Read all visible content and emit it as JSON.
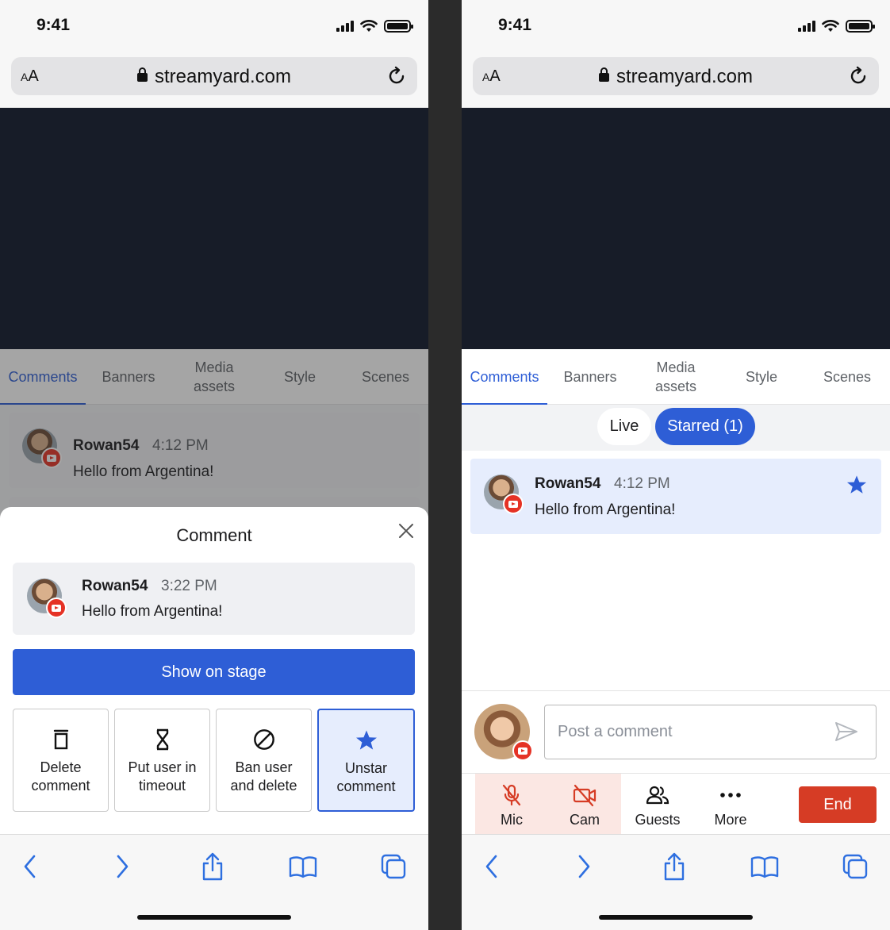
{
  "status_bar": {
    "time": "9:41"
  },
  "browser": {
    "aa_small": "A",
    "aa_large": "A",
    "url": "streamyard.com"
  },
  "tabs": [
    {
      "line1": "Comments",
      "line2": ""
    },
    {
      "line1": "Banners",
      "line2": ""
    },
    {
      "line1": "Media",
      "line2": "assets"
    },
    {
      "line1": "Style",
      "line2": ""
    },
    {
      "line1": "Scenes",
      "line2": ""
    }
  ],
  "left": {
    "background_comment": {
      "author": "Rowan54",
      "time": "4:12 PM",
      "text": "Hello from Argentina!"
    },
    "sheet": {
      "title": "Comment",
      "comment": {
        "author": "Rowan54",
        "time": "3:22 PM",
        "text": "Hello from Argentina!"
      },
      "show_on_stage": "Show on stage",
      "actions": [
        {
          "line1": "Delete",
          "line2": "comment",
          "icon": "trash-icon"
        },
        {
          "line1": "Put user in",
          "line2": "timeout",
          "icon": "hourglass-icon"
        },
        {
          "line1": "Ban user",
          "line2": "and delete",
          "icon": "ban-icon"
        },
        {
          "line1": "Unstar",
          "line2": "comment",
          "icon": "star-icon"
        }
      ]
    }
  },
  "right": {
    "filters": {
      "live": "Live",
      "starred": "Starred (1)"
    },
    "comment": {
      "author": "Rowan54",
      "time": "4:12 PM",
      "text": "Hello from Argentina!"
    },
    "composer": {
      "placeholder": "Post a comment"
    },
    "controls": {
      "mic": "Mic",
      "cam": "Cam",
      "guests": "Guests",
      "more": "More",
      "end": "End"
    }
  },
  "colors": {
    "accent": "#2e5ed6",
    "danger": "#d63c25",
    "stage": "#171c28",
    "youtube": "#e53225"
  }
}
